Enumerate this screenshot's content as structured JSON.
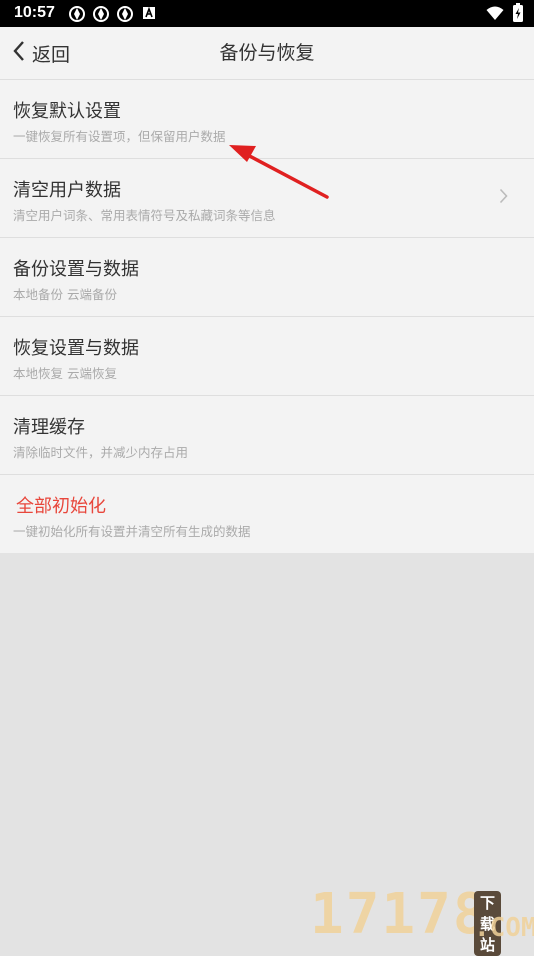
{
  "status": {
    "time": "10:57"
  },
  "header": {
    "back_label": "返回",
    "title": "备份与恢复"
  },
  "items": [
    {
      "title": "恢复默认设置",
      "subtitle": "一键恢复所有设置项，但保留用户数据",
      "chevron": false
    },
    {
      "title": "清空用户数据",
      "subtitle": "清空用户词条、常用表情符号及私藏词条等信息",
      "chevron": true
    },
    {
      "title": "备份设置与数据",
      "subtitle": "本地备份 云端备份",
      "chevron": false
    },
    {
      "title": "恢复设置与数据",
      "subtitle": "本地恢复 云端恢复",
      "chevron": false
    },
    {
      "title": "清理缓存",
      "subtitle": "清除临时文件，并减少内存占用",
      "chevron": false
    },
    {
      "title": "全部初始化",
      "subtitle": "一键初始化所有设置并清空所有生成的数据",
      "chevron": false,
      "danger": true
    }
  ],
  "watermark": {
    "digits": "17178",
    "tag": "下载站",
    "domain": ".COM"
  },
  "colors": {
    "danger": "#e8473c",
    "annotation_arrow": "#e02020"
  }
}
